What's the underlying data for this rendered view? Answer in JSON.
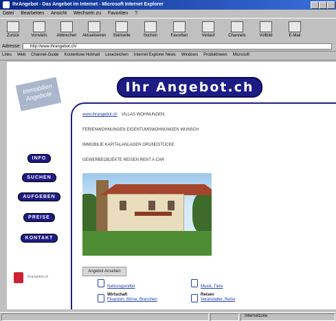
{
  "window": {
    "title": "IhrAngebot - Das Angebot im Internet - Microsoft Internet Explorer"
  },
  "menu": [
    "Datei",
    "Bearbeiten",
    "Ansicht",
    "Wechseln zu",
    "Favoriten",
    "?"
  ],
  "toolbar": [
    {
      "label": "Zurück",
      "icon": "back-icon"
    },
    {
      "label": "Vorwärts",
      "icon": "forward-icon"
    },
    {
      "label": "Abbrechen",
      "icon": "stop-icon"
    },
    {
      "label": "Aktualisieren",
      "icon": "refresh-icon"
    },
    {
      "label": "Startseite",
      "icon": "home-icon"
    },
    {
      "label": "Suchen",
      "icon": "search-icon"
    },
    {
      "label": "Favoriten",
      "icon": "favorites-icon"
    },
    {
      "label": "Verlauf",
      "icon": "history-icon"
    },
    {
      "label": "Channels",
      "icon": "channels-icon"
    },
    {
      "label": "Vollbild",
      "icon": "fullscreen-icon"
    },
    {
      "label": "E-Mail",
      "icon": "mail-icon"
    }
  ],
  "address": {
    "label": "Adresse",
    "url": "http://www.ihrangebot.ch/"
  },
  "links": {
    "label": "Links",
    "items": [
      "Web",
      "Channel-Guide",
      "Kostenlose Hotmail",
      "Lesezeichen",
      "Internet Explorer News",
      "Windows",
      "Produktnews",
      "Microsoft"
    ]
  },
  "sidebar": {
    "card_label": "Immobilien Angebote",
    "nav": [
      "INFO",
      "SUCHEN",
      "AUFGEBEN",
      "PREISE",
      "KONTAKT"
    ],
    "small_logo_text": "ihrangebot.ch"
  },
  "main": {
    "headline": "Ihr Angebot.ch",
    "lines": [
      {
        "link": "www.ihrangebot.ch",
        "text": "VILLAS WOHNUNGEN"
      },
      {
        "text": "FERIENWOHNUNGEN EIGENTUMSWOHNUNGEN WUNSCH"
      },
      {
        "text": "IMMOBILIE KAPITALANLAGEN GRUNDSTÜCKE"
      },
      {
        "text": "GEWERBEOBJEKTE REISEN RENT A CAR"
      }
    ],
    "button": "Angebot Ansehen",
    "categories": [
      {
        "title": "",
        "links": "Nahrungsmittel"
      },
      {
        "title": "",
        "links": "Musik, Tiere"
      },
      {
        "title": "Wirtschaft",
        "links": "Finanzen, Börse, Branchen"
      },
      {
        "title": "Reisen",
        "links": "Veranstalter, Reise"
      }
    ]
  },
  "status": {
    "zone": "Internetzone"
  }
}
